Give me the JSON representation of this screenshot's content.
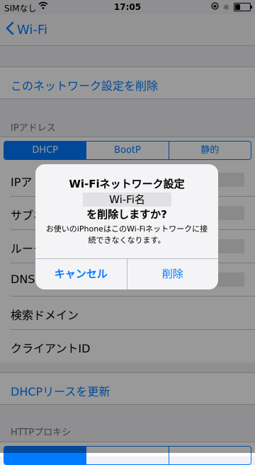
{
  "status_bar": {
    "carrier": "SIMなし",
    "time": "17:05",
    "battery_level": 0.35
  },
  "nav": {
    "back_label": "Wi-Fi"
  },
  "forget_network_label": "このネットワーク設定を削除",
  "ip_section": {
    "label": "IPアドレス",
    "segments": [
      {
        "label": "DHCP",
        "active": true
      },
      {
        "label": "BootP",
        "active": false
      },
      {
        "label": "静的",
        "active": false
      }
    ]
  },
  "ip_rows": [
    {
      "label": "IPアドレス"
    },
    {
      "label": "サブネットマスク"
    },
    {
      "label": "ルーター"
    },
    {
      "label": "DNS"
    },
    {
      "label": "検索ドメイン"
    },
    {
      "label": "クライアントID"
    }
  ],
  "renew_lease_label": "DHCPリースを更新",
  "http_proxy_label": "HTTPプロキシ",
  "alert": {
    "title_line1": "Wi-Fiネットワーク設定",
    "network_name": "Wi-Fi名",
    "title_line2": "を削除しますか?",
    "message": "お使いのiPhoneはこのWi-Fiネットワークに接続できなくなります。",
    "cancel_label": "キャンセル",
    "delete_label": "削除"
  },
  "colors": {
    "accent": "#007aff",
    "background": "#efeff4"
  }
}
